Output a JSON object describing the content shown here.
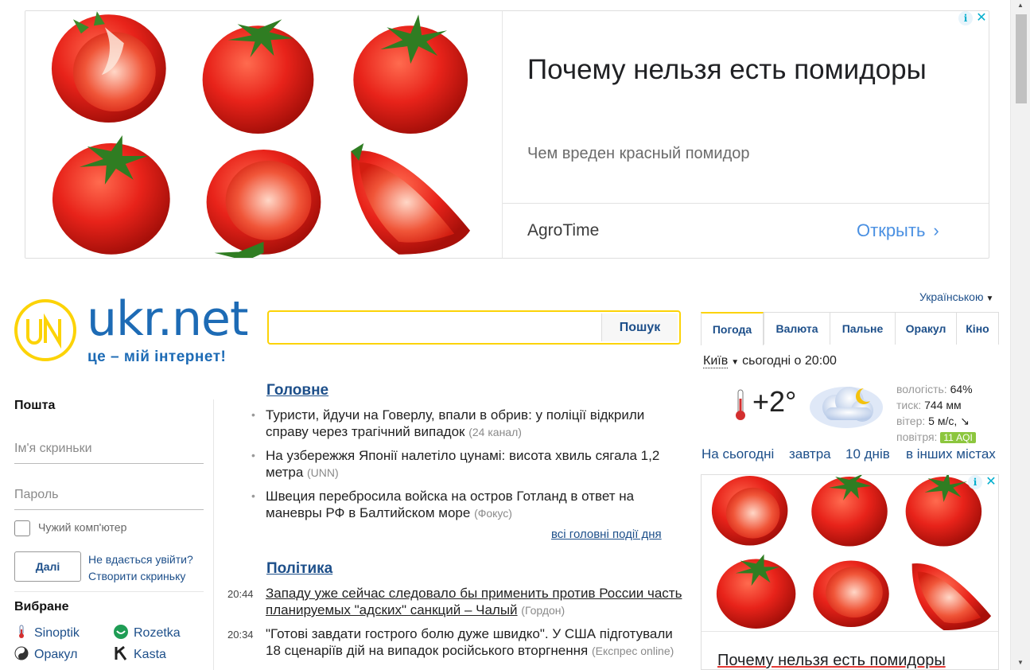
{
  "ad_top": {
    "headline": "Почему нельзя есть помидоры",
    "subtitle": "Чем вреден красный помидор",
    "advertiser": "AgroTime",
    "cta": "Открыть",
    "cta_chevron": "›",
    "info_icon": "i",
    "close_icon": "✕"
  },
  "header": {
    "logo_name": "ukr.net",
    "logo_slogan": "це – мій інтернет!",
    "language": "Українською",
    "search": {
      "placeholder": "",
      "button": "Пошук"
    }
  },
  "mail": {
    "title": "Пошта",
    "login_placeholder": "Ім'я скриньки",
    "password_placeholder": "Пароль",
    "foreign_computer": "Чужий комп'ютер",
    "next": "Далі",
    "cant_login": "Не вдається увійти?",
    "create_box": "Створити скриньку"
  },
  "favorites": {
    "title": "Вибране",
    "items": [
      {
        "label": "Sinoptik",
        "icon": "thermometer-icon"
      },
      {
        "label": "Rozetka",
        "icon": "rozetka-icon"
      },
      {
        "label": "Оракул",
        "icon": "yin-yang-icon"
      },
      {
        "label": "Kasta",
        "icon": "kasta-icon"
      }
    ]
  },
  "news": {
    "main": {
      "title": "Головне",
      "items": [
        {
          "text": "Туристи, йдучи на Говерлу, впали в обрив: у поліції відкрили справу через трагічний випадок",
          "source": "(24 канал)"
        },
        {
          "text": "На узбережжя Японії налетіло цунамі: висота хвиль сягала 1,2 метра",
          "source": "(UNN)"
        },
        {
          "text": "Швеция перебросила войска на остров Готланд в ответ на маневры РФ в Балтийском море",
          "source": "(Фокус)"
        }
      ],
      "all_link": "всі головні події дня"
    },
    "politics": {
      "title": "Політика",
      "items": [
        {
          "time": "20:44",
          "text": "Западу уже сейчас следовало бы применить против России часть планируемых \"адских\" санкций – Чалый",
          "source": "(Гордон)"
        },
        {
          "time": "20:34",
          "text": "\"Готові завдати гострого болю дуже швидко\". У США підготували 18 сценаріїв дій на випадок російського вторгнення",
          "source": "(Експрес online)"
        }
      ]
    }
  },
  "tabs": [
    "Погода",
    "Валюта",
    "Пальне",
    "Оракул",
    "Кіно"
  ],
  "weather": {
    "city": "Київ",
    "today_label": "сьогодні о 20:00",
    "temperature": "+2°",
    "humidity_label": "вологість:",
    "humidity": "64%",
    "pressure_label": "тиск:",
    "pressure": "744 мм",
    "wind_label": "вітер:",
    "wind": "5 м/с, ↘",
    "air_label": "повітря:",
    "air": "11 AQI",
    "links": [
      "На сьогодні",
      "завтра",
      "10 днів",
      "в інших містах"
    ]
  },
  "ad_right": {
    "headline": "Почему нельзя есть помидоры",
    "info_icon": "i",
    "close_icon": "✕"
  },
  "colors": {
    "brand_blue": "#1d6bb5",
    "link_blue": "#1d4f8a",
    "accent_yellow": "#fcd307",
    "tomato_red": "#e01e10",
    "aqi_green": "#8cc63e"
  }
}
